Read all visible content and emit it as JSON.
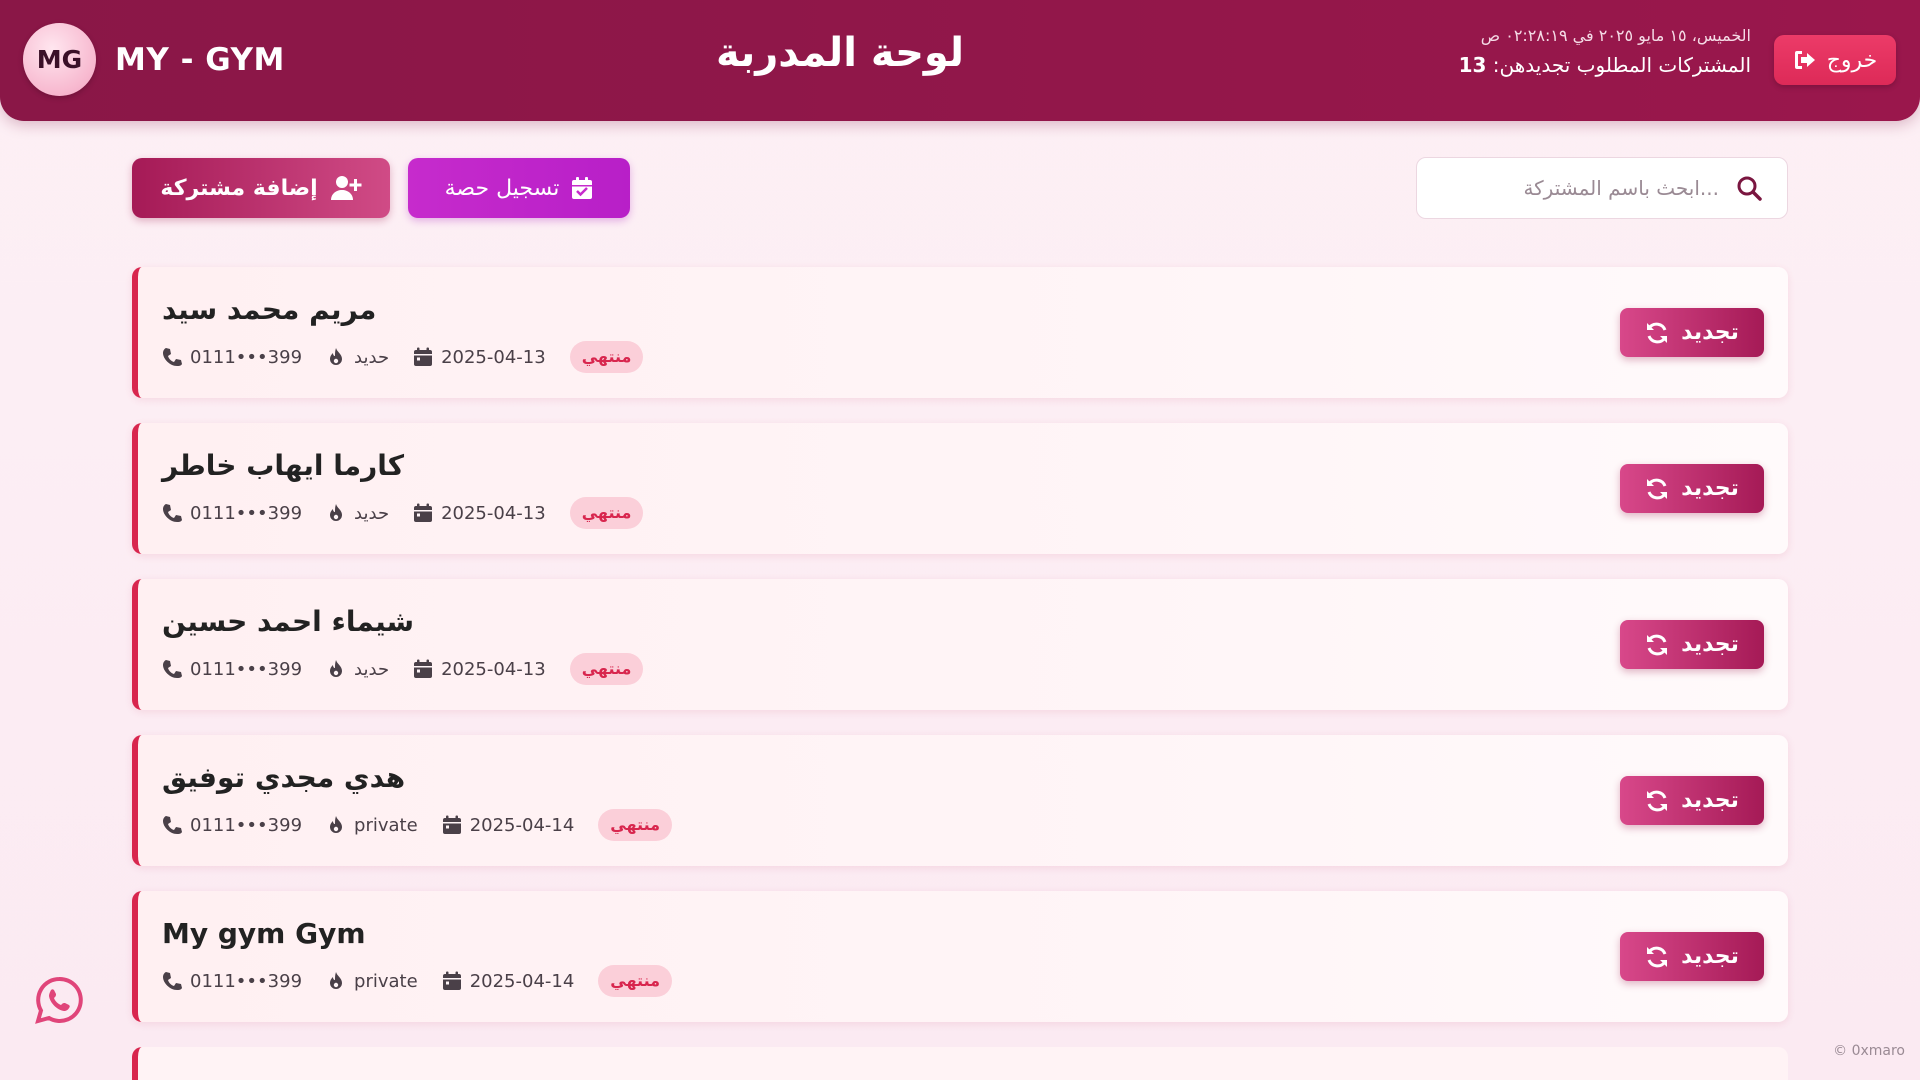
{
  "header": {
    "logo_initials": "MG",
    "brand_name": "MY - GYM",
    "title": "لوحة المدربة",
    "datetime": "الخميس، ١٥ مايو ٢٠٢٥ في ٠٢:٢٨:١٩ ص",
    "renew_label": "المشتركات المطلوب تجديدهن:",
    "renew_count": "13",
    "logout_label": "خروج"
  },
  "toolbar": {
    "search_placeholder": "...ابحث باسم المشتركة",
    "add_member_label": "إضافة مشتركة",
    "log_session_label": "تسجيل حصة"
  },
  "members": [
    {
      "name": "مريم محمد سيد",
      "status": "منتهي",
      "date": "2025-04-13",
      "plan": "حديد",
      "phone": "0111•••399",
      "renew_label": "تجديد"
    },
    {
      "name": "كارما ايهاب خاطر",
      "status": "منتهي",
      "date": "2025-04-13",
      "plan": "حديد",
      "phone": "0111•••399",
      "renew_label": "تجديد"
    },
    {
      "name": "شيماء احمد حسين",
      "status": "منتهي",
      "date": "2025-04-13",
      "plan": "حديد",
      "phone": "0111•••399",
      "renew_label": "تجديد"
    },
    {
      "name": "هدي مجدي توفيق",
      "status": "منتهي",
      "date": "2025-04-14",
      "plan": "private",
      "phone": "0111•••399",
      "renew_label": "تجديد"
    },
    {
      "name": "My gym Gym",
      "status": "منتهي",
      "date": "2025-04-14",
      "plan": "private",
      "phone": "0111•••399",
      "renew_label": "تجديد"
    }
  ],
  "footer": {
    "credit": "© 0xmaro"
  },
  "colors": {
    "header": "#8f1749",
    "accent": "#d8264e",
    "session_button": "#c62bcc",
    "logout": "#e8335f"
  },
  "icons": [
    "sign-out-icon",
    "search-icon",
    "user-plus-icon",
    "calendar-check-icon",
    "sync-icon",
    "phone-icon",
    "fire-icon",
    "calendar-icon",
    "whatsapp-icon"
  ]
}
